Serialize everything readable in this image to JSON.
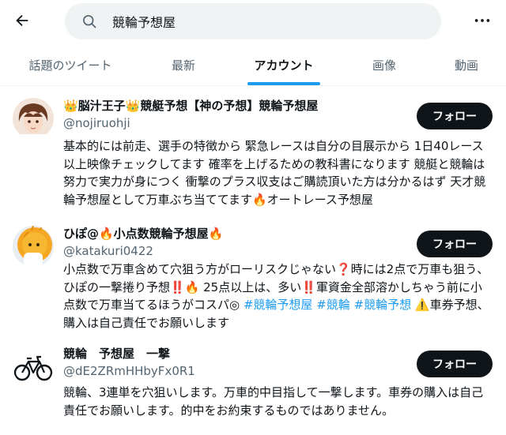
{
  "search": {
    "query": "競輪予想屋"
  },
  "tabs": [
    {
      "label": "話題のツイート"
    },
    {
      "label": "最新"
    },
    {
      "label": "アカウント"
    },
    {
      "label": "画像"
    },
    {
      "label": "動画"
    }
  ],
  "users": [
    {
      "name": "👑脳汁王子👑競艇予想【神の予想】競輪予想屋",
      "handle": "@nojiruohji",
      "follow_label": "フォロー",
      "bio": [
        {
          "t": "基本的には前走、選手の特徴から 緊急レースは自分の目展示から 1日40レース以上映像チェックしてます 確率を上げるための教科書になります 競艇と競輪は努力で実力が身につく 衝撃のプラス収支はご購読頂いた方は分かるはず 天才競輪予想屋として万車ぶち当ててます🔥オートレース予想屋"
        }
      ]
    },
    {
      "name": "ひぽ@🔥小点数競輪予想屋🔥",
      "handle": "@katakuri0422",
      "follow_label": "フォロー",
      "bio": [
        {
          "t": "小点数で万車含めて穴狙う方がローリスクじゃない❓時には2点で万車も狙う、ひぽの一撃捲り予想‼️🔥 25点以上は、多い‼️軍資金全部溶かしちゃう前に小点数で万車当てるほうがコスパ◎ "
        },
        {
          "t": "#競輪予想屋",
          "tag": true
        },
        {
          "t": " "
        },
        {
          "t": "#競輪",
          "tag": true
        },
        {
          "t": " "
        },
        {
          "t": "#競輪予想",
          "tag": true
        },
        {
          "t": " ⚠️車券予想、購入は自己責任でお願いします"
        }
      ]
    },
    {
      "name": "競輪　予想屋　一撃",
      "handle": "@dE2ZRmHHbyFx0R1",
      "follow_label": "フォロー",
      "bio": [
        {
          "t": "競輪、3連単を穴狙いします。万車的中目指して一撃します。車券の購入は自己責任でお願いします。的中をお約束するものではありません。"
        }
      ]
    }
  ]
}
